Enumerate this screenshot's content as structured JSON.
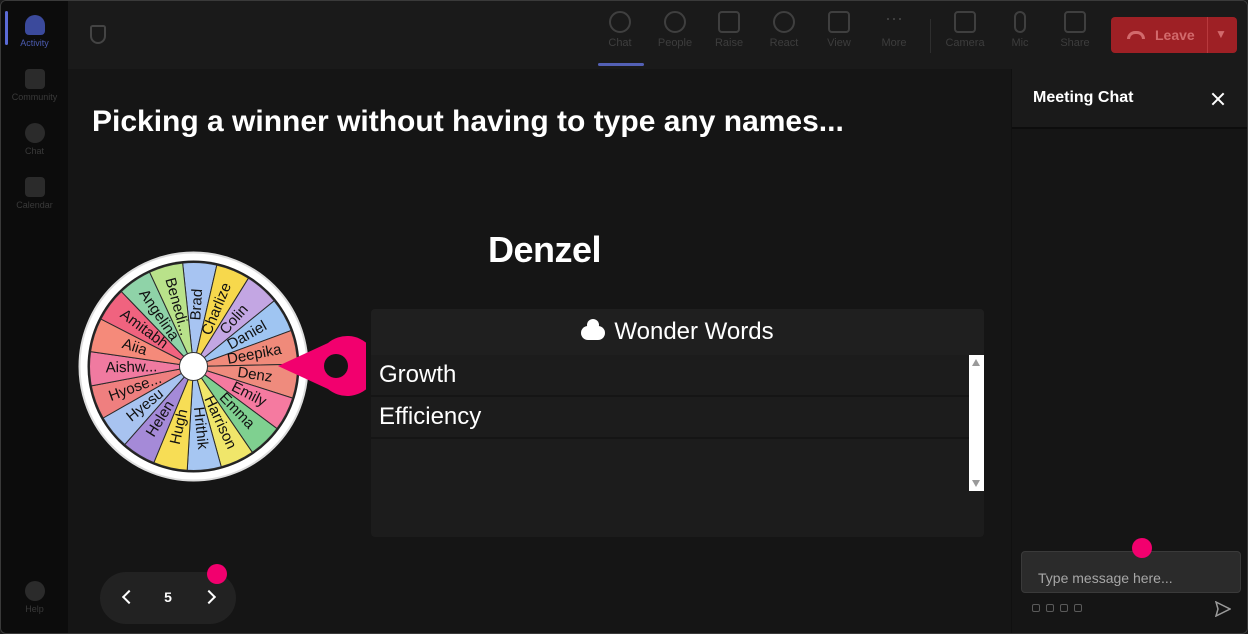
{
  "rail": {
    "items": [
      {
        "label": "Activity"
      },
      {
        "label": "Community"
      },
      {
        "label": "Chat"
      },
      {
        "label": "Calendar"
      }
    ],
    "help_label": "Help"
  },
  "toolbar": {
    "buttons": [
      {
        "label": "Chat",
        "icon": "chat-bubble-icon"
      },
      {
        "label": "People",
        "icon": "people-icon"
      },
      {
        "label": "Raise",
        "icon": "raise-hand-icon"
      },
      {
        "label": "React",
        "icon": "smiley-icon"
      },
      {
        "label": "View",
        "icon": "grid-icon"
      },
      {
        "label": "More",
        "icon": "ellipsis-icon"
      },
      {
        "label": "Camera",
        "icon": "camera-off-icon"
      },
      {
        "label": "Mic",
        "icon": "mic-icon"
      },
      {
        "label": "Share",
        "icon": "share-icon"
      }
    ],
    "leave_label": "Leave"
  },
  "stage": {
    "title": "Picking a winner without having to type any names...",
    "winner": "Denzel",
    "wheel": {
      "names": [
        "Brad",
        "Charlize",
        "Colin",
        "Daniel",
        "Deepika",
        "Denz",
        "Emily",
        "Emma",
        "Harrison",
        "Hrithik",
        "Hugh",
        "Helen",
        "Hyesu",
        "Hyose...",
        "Aishw...",
        "Aiia",
        "Amitabh",
        "Angelina",
        "Benedi..."
      ],
      "colors": [
        "#a7c4f2",
        "#f7d84c",
        "#c3a6e3",
        "#9fc5f2",
        "#f08a7a",
        "#ef8b7d",
        "#f57aa0",
        "#7fd090",
        "#f0e66a",
        "#a6c6f2",
        "#f7dd55",
        "#a58ad8",
        "#a8c3f0",
        "#ef7f7f",
        "#f07aa0",
        "#f58a7a",
        "#f0637f",
        "#8fd3a8",
        "#b9e28a"
      ]
    },
    "wonder_words": {
      "title": "Wonder Words",
      "items": [
        "Growth",
        "Efficiency"
      ]
    },
    "pager": {
      "page": "5"
    }
  },
  "chat": {
    "title": "Meeting Chat",
    "input_placeholder": "Type message here..."
  },
  "colors": {
    "accent": "#5360b5",
    "leave": "#9e2025",
    "marker": "#f2006e"
  }
}
